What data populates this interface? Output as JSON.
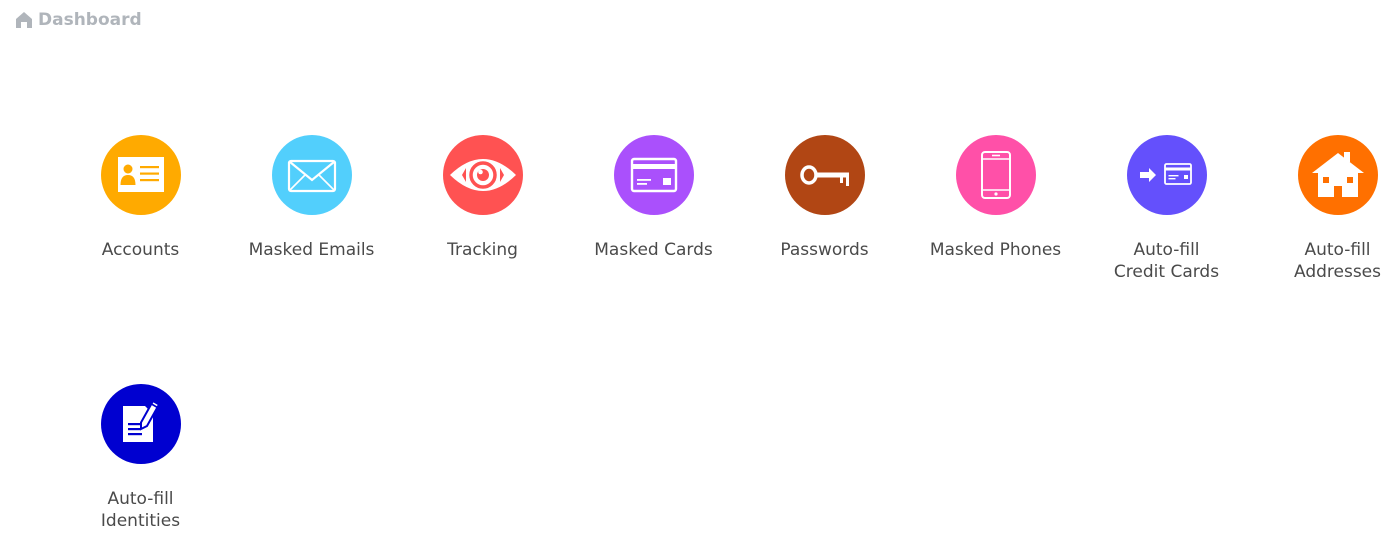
{
  "breadcrumb": {
    "icon": "home-icon",
    "label": "Dashboard"
  },
  "tiles": [
    {
      "id": "accounts",
      "label": "Accounts",
      "icon": "id-card-icon",
      "color": "#FFAA00"
    },
    {
      "id": "masked-emails",
      "label": "Masked Emails",
      "icon": "envelope-icon",
      "color": "#52CFFC"
    },
    {
      "id": "tracking",
      "label": "Tracking",
      "icon": "eye-icon",
      "color": "#FF5252"
    },
    {
      "id": "masked-cards",
      "label": "Masked Cards",
      "icon": "credit-card-icon",
      "color": "#AA50FC"
    },
    {
      "id": "passwords",
      "label": "Passwords",
      "icon": "key-icon",
      "color": "#B14614"
    },
    {
      "id": "masked-phones",
      "label": "Masked Phones",
      "icon": "phone-icon",
      "color": "#FF50A8"
    },
    {
      "id": "autofill-credit-cards",
      "label": "Auto-fill\nCredit Cards",
      "icon": "arrow-card-icon",
      "color": "#6450FC"
    },
    {
      "id": "autofill-addresses",
      "label": "Auto-fill\nAddresses",
      "icon": "house-icon",
      "color": "#FF7000"
    },
    {
      "id": "autofill-identities",
      "label": "Auto-fill\nIdentities",
      "icon": "document-pencil-icon",
      "color": "#0000D0"
    }
  ]
}
